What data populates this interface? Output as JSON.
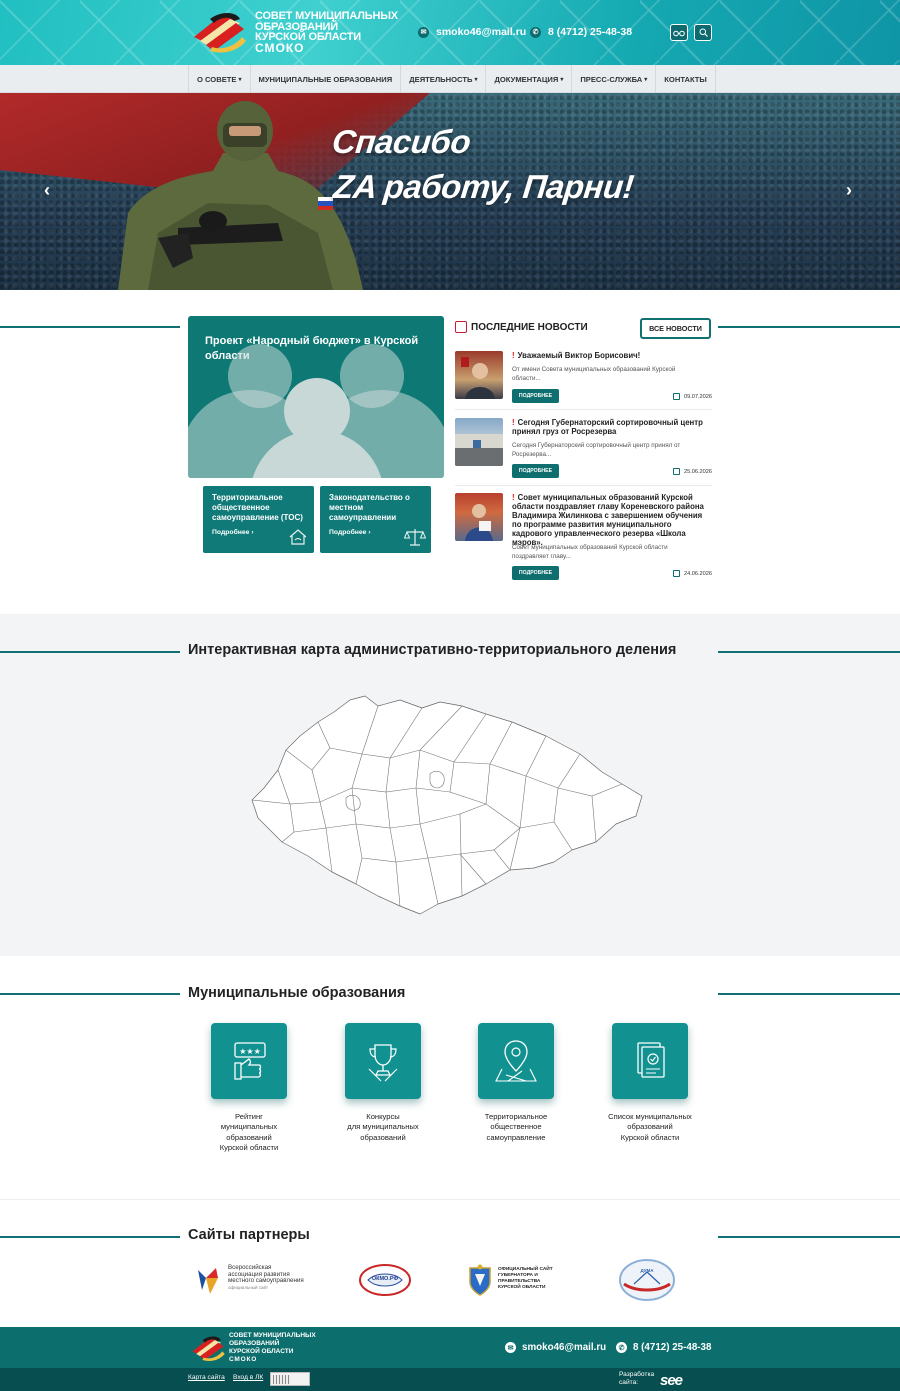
{
  "header": {
    "logo_lines": [
      "Совет муниципальных",
      "образований",
      "Курской области"
    ],
    "logo_abbr": "СМОКО",
    "email": "smoko46@mail.ru",
    "phone": "8 (4712) 25-48-38",
    "accessibility_icon": "glasses-icon",
    "search_icon": "search-icon"
  },
  "nav": {
    "items": [
      {
        "label": "О СОВЕТЕ",
        "has_dropdown": true
      },
      {
        "label": "МУНИЦИПАЛЬНЫЕ ОБРАЗОВАНИЯ",
        "has_dropdown": false
      },
      {
        "label": "ДЕЯТЕЛЬНОСТЬ",
        "has_dropdown": true
      },
      {
        "label": "ДОКУМЕНТАЦИЯ",
        "has_dropdown": true
      },
      {
        "label": "ПРЕСС-СЛУЖБА",
        "has_dropdown": true
      },
      {
        "label": "КОНТАКТЫ",
        "has_dropdown": false
      }
    ]
  },
  "hero": {
    "line1": "Спасибо",
    "line2": "ZA работу, Парни!",
    "prev": "‹",
    "next": "›"
  },
  "budget": {
    "title": "Проект «Народный бюджет» в Курской области"
  },
  "cards": [
    {
      "title": "Территориальное общественное самоуправление (ТОС)",
      "more": "Подробнее",
      "icon": "house-hands-icon"
    },
    {
      "title": "Законодательство о местном самоуправлении",
      "more": "Подробнее",
      "icon": "scales-icon"
    }
  ],
  "news": {
    "heading": "ПОСЛЕДНИЕ НОВОСТИ",
    "all_label": "ВСЕ НОВОСТИ",
    "more_label": "ПОДРОБНЕЕ",
    "items": [
      {
        "title": "Уважаемый Виктор Борисович!",
        "excerpt": "От имени Совета муниципальных образований Курской области...",
        "date": "09.07.2026"
      },
      {
        "title": "Сегодня Губернаторский сортировочный центр принял груз от Росрезерва",
        "excerpt": "Сегодня Губернаторский сортировочный центр принял от Росрезерва...",
        "date": "25.06.2026"
      },
      {
        "title": "Совет муниципальных образований Курской области поздравляет главу Кореневского района Владимира Жилинкова с завершением обучения по программе развития муниципального кадрового управленческого резерва «Школа мэров».",
        "excerpt": "Совет муниципальных образований Курской области поздравляет главу...",
        "date": "24.06.2026"
      }
    ]
  },
  "map": {
    "title": "Интерактивная карта административно-территориального деления"
  },
  "municipal": {
    "title": "Муниципальные образования",
    "items": [
      {
        "label_lines": [
          "Рейтинг",
          "муниципальных",
          "образований",
          "Курской области"
        ],
        "icon": "rating-thumb-icon"
      },
      {
        "label_lines": [
          "Конкурсы",
          "для муниципальных",
          "образований"
        ],
        "icon": "trophy-icon"
      },
      {
        "label_lines": [
          "Территориальное",
          "общественное",
          "самоуправление"
        ],
        "icon": "map-pin-icon"
      },
      {
        "label_lines": [
          "Список муниципальных",
          "образований",
          "Курской области"
        ],
        "icon": "document-list-icon"
      }
    ]
  },
  "partners": {
    "title": "Сайты партнеры",
    "vaRMSU_lines": [
      "Всероссийская",
      "ассоциация развития",
      "местного самоуправления"
    ],
    "vaRMSU_sub": "официальный сайт",
    "okmo": "ОКМО.РФ",
    "gov_lines": [
      "ОФИЦИАЛЬНЫЙ САЙТ",
      "ГУБЕРНАТОРА И",
      "ПРАВИТЕЛЬСТВА",
      "КУРСКОЙ ОБЛАСТИ"
    ],
    "duma": "ДУМА"
  },
  "footer": {
    "logo_lines": [
      "Совет муниципальных",
      "образований",
      "Курской области"
    ],
    "logo_abbr": "СМОКО",
    "email": "smoko46@mail.ru",
    "phone": "8 (4712) 25-48-38",
    "sitemap": "Карта сайта",
    "login": "Вход в ЛК",
    "dev_lines": [
      "Разработка",
      "сайта:"
    ],
    "dev_logo": "see"
  },
  "colors": {
    "teal": "#0d7874",
    "dark_teal": "#064e4f",
    "accent_red": "#d21b1b"
  }
}
